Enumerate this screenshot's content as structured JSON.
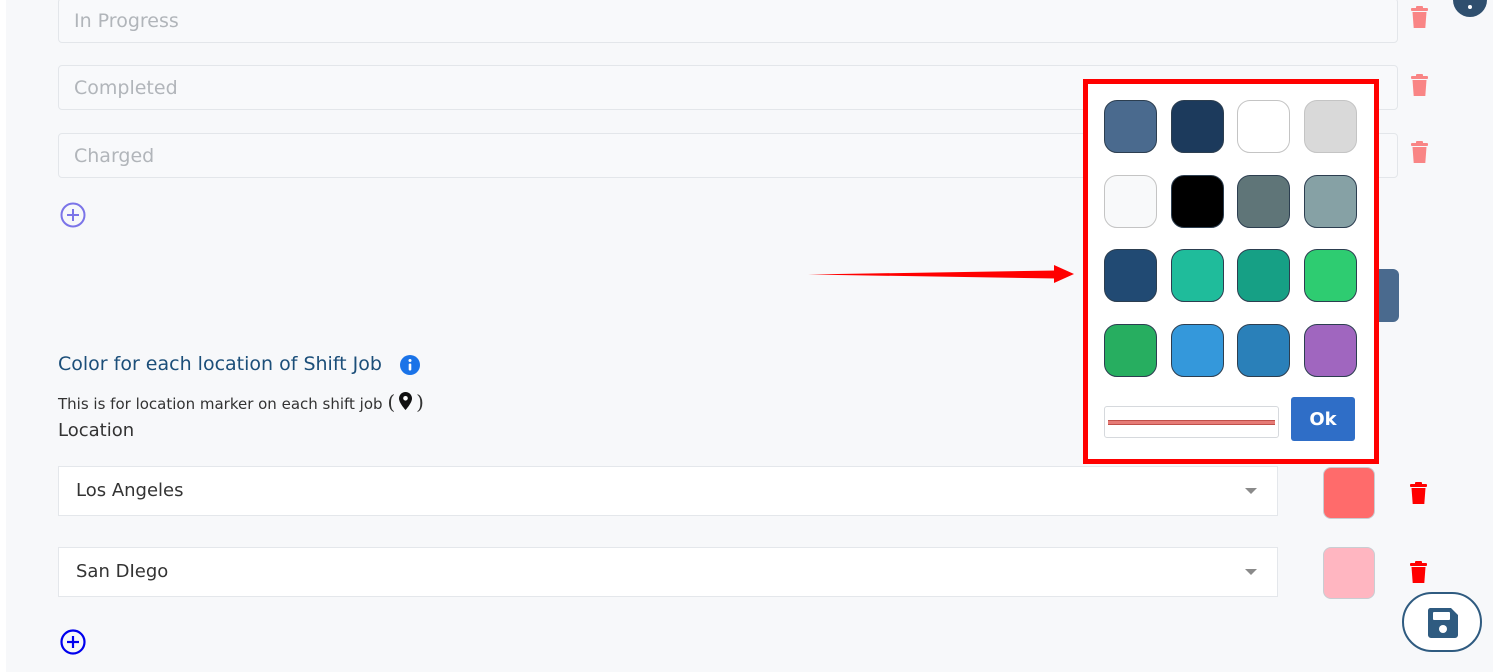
{
  "statuses": [
    {
      "placeholder": "In Progress"
    },
    {
      "placeholder": "Completed"
    },
    {
      "placeholder": "Charged"
    }
  ],
  "location_section": {
    "title": "Color for each location of Shift Job",
    "subtitle": "This is for location marker on each shift job",
    "subtitle_open": "(",
    "subtitle_close": ")",
    "label": "Location",
    "rows": [
      {
        "value": "Los Angeles",
        "color": "#ff6b6b"
      },
      {
        "value": "San DIego",
        "color": "#ffb6c1"
      }
    ]
  },
  "color_picker": {
    "swatches": [
      "#4a6a8e",
      "#1c3a5c",
      "#ffffff",
      "#d9d9d9",
      "#f8f9fa",
      "#000000",
      "#5f7578",
      "#86a1a5",
      "#214a73",
      "#1fbc9b",
      "#16a085",
      "#2ecc71",
      "#27ae60",
      "#3498db",
      "#2a80b9",
      "#a066bf"
    ],
    "current_color": "#e67b76",
    "ok_label": "Ok"
  },
  "icons": {
    "delete": "trash-icon",
    "add": "plus-circle-icon",
    "info": "info-icon",
    "location": "map-pin-icon",
    "save": "floppy-disk-icon",
    "help": "help-icon"
  },
  "colors": {
    "primary": "#1b4e79",
    "accent_blue": "#2f6ec7",
    "delete_red": "#ff0000",
    "delete_faded": "#f98585",
    "highlight_red": "#ff0000"
  }
}
